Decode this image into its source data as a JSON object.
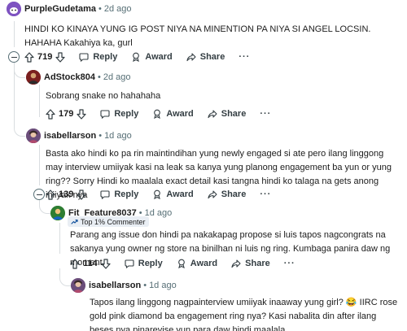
{
  "comments": [
    {
      "username": "PurpleGudetama",
      "time": "2d ago",
      "text": "HINDI KO KINAYA YUNG IG POST NIYA NA MINENTION PA NIYA SI ANGEL LOCSIN. HAHAHA Kakahiya ka, gurl",
      "score": "719",
      "actions": {
        "reply": "Reply",
        "award": "Award",
        "share": "Share",
        "more": "···"
      },
      "avatar_color": "#7e53c1"
    },
    {
      "username": "AdStock804",
      "time": "2d ago",
      "text": "Sobrang snake no hahahaha",
      "score": "179",
      "actions": {
        "reply": "Reply",
        "award": "Award",
        "share": "Share",
        "more": "···"
      },
      "avatar_color": "#7a1f1f"
    },
    {
      "username": "isabellarson",
      "time": "1d ago",
      "text": "Basta ako hindi ko pa rin maintindihan yung newly engaged si ate pero ilang linggong may interview umiiyak kasi na leak sa kanya yung planong engagement ba yun or yung ring?? Sorry Hindi ko maalala exact detail kasi tangna hindi ko talaga na gets anong iniiyak nya",
      "score": "139",
      "actions": {
        "reply": "Reply",
        "award": "Award",
        "share": "Share",
        "more": "···"
      },
      "avatar_color": "#6b4d7a"
    },
    {
      "username": "Fit_Feature8037",
      "time": "1d ago",
      "badge": "Top 1% Commenter",
      "text": "Parang ang issue don hindi pa nakakapag propose si luis tapos nagcongrats na sakanya yung owner ng store na binilhan ni luis ng ring. Kumbaga panira daw ng moment.",
      "score": "114",
      "actions": {
        "reply": "Reply",
        "award": "Award",
        "share": "Share",
        "more": "···"
      },
      "avatar_color": "#2e7d32"
    },
    {
      "username": "isabellarson",
      "time": "1d ago",
      "text_before": "Tapos ilang linggong nagpainterview umiiyak inaaway yung girl? ",
      "emoji": "😂",
      "text_after": " IIRC rose gold pink diamond ba engagement ring nya? Kasi nabalita din after ilang beses nya pinarevise yun para daw hindi maalala",
      "avatar_color": "#6b4d7a"
    }
  ],
  "colors": {
    "text": "#1c1c1c",
    "meta": "#576f76",
    "thread_line": "#d9dde0",
    "badge_bg": "#e9eef4"
  }
}
